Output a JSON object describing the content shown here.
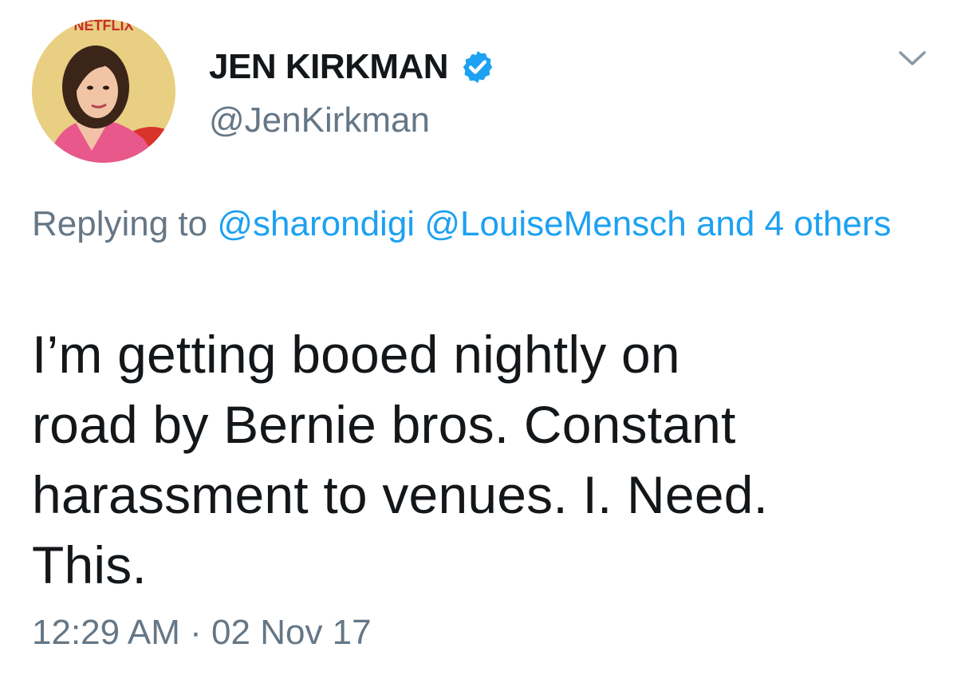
{
  "tweet": {
    "display_name": "JEN KIRKMAN",
    "handle": "@JenKirkman",
    "verified": true,
    "reply": {
      "prefix": "Replying to",
      "mention_1": "@sharondigi",
      "mention_2": "@LouiseMensch",
      "others": "and 4 others"
    },
    "text_lines": [
      "I’m getting booed nightly on",
      "road by Bernie bros. Constant",
      "harassment to venues. I. Need.",
      "This."
    ],
    "time": "12:29 AM",
    "separator": "·",
    "date": "02 Nov 17"
  },
  "avatar_banner_text": "NETFLIX",
  "colors": {
    "text_primary": "#14171a",
    "text_secondary": "#657786",
    "link": "#1da1f2",
    "verified_badge": "#1da1f2"
  }
}
